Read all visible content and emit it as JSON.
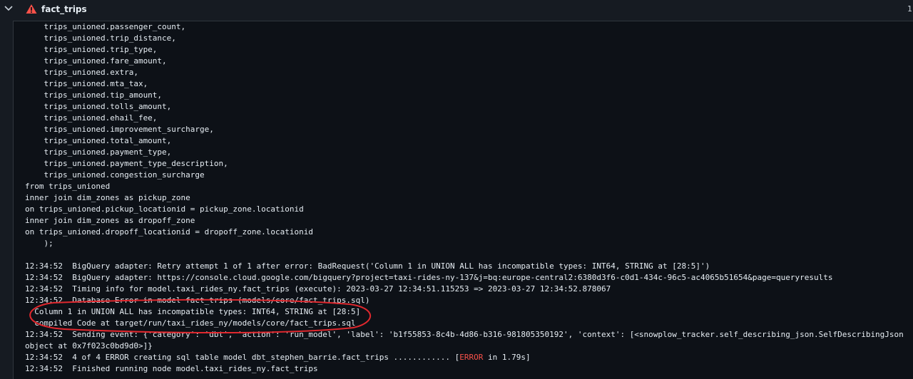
{
  "job": {
    "title": "fact_trips",
    "corner_text": "1",
    "status_color": "#f85149"
  },
  "lines": [
    "    trips_unioned.passenger_count,",
    "    trips_unioned.trip_distance,",
    "    trips_unioned.trip_type,",
    "    trips_unioned.fare_amount,",
    "    trips_unioned.extra,",
    "    trips_unioned.mta_tax,",
    "    trips_unioned.tip_amount,",
    "    trips_unioned.tolls_amount,",
    "    trips_unioned.ehail_fee,",
    "    trips_unioned.improvement_surcharge,",
    "    trips_unioned.total_amount,",
    "    trips_unioned.payment_type,",
    "    trips_unioned.payment_type_description,",
    "    trips_unioned.congestion_surcharge",
    "from trips_unioned",
    "inner join dim_zones as pickup_zone",
    "on trips_unioned.pickup_locationid = pickup_zone.locationid",
    "inner join dim_zones as dropoff_zone",
    "on trips_unioned.dropoff_locationid = dropoff_zone.locationid",
    "    );",
    "",
    "12:34:52  BigQuery adapter: Retry attempt 1 of 1 after error: BadRequest('Column 1 in UNION ALL has incompatible types: INT64, STRING at [28:5]')",
    "12:34:52  BigQuery adapter: https://console.cloud.google.com/bigquery?project=taxi-rides-ny-137&j=bq:europe-central2:6380d3f6-c0d1-434c-96c5-ac4065b51654&page=queryresults",
    "12:34:52  Timing info for model.taxi_rides_ny.fact_trips (execute): 2023-03-27 12:34:51.115253 => 2023-03-27 12:34:52.878067",
    "12:34:52  Database Error in model fact_trips (models/core/fact_trips.sql)",
    "  Column 1 in UNION ALL has incompatible types: INT64, STRING at [28:5]",
    "  compiled Code at target/run/taxi_rides_ny/models/core/fact_trips.sql",
    "12:34:52  Sending event: {'category': 'dbt', 'action': 'run_model', 'label': 'b1f55853-8c4b-4d86-b316-981805350192', 'context': [<snowplow_tracker.self_describing_json.SelfDescribingJson",
    "object at 0x7f023c0bd9d0>]}"
  ],
  "error_line": {
    "before": "12:34:52  4 of 4 ERROR creating sql table model dbt_stephen_barrie.fact_trips ............ [",
    "tag": "ERROR",
    "after": " in 1.79s]"
  },
  "last_line": "12:34:52  Finished running node model.taxi_rides_ny.fact_trips",
  "annotation_color": "#e0282e"
}
